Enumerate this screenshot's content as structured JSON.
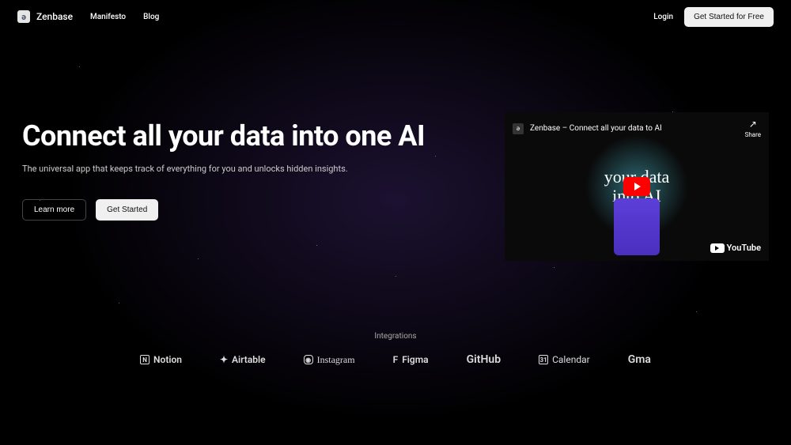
{
  "header": {
    "logo_text": "Zenbase",
    "nav": {
      "manifesto": "Manifesto",
      "blog": "Blog"
    },
    "login": "Login",
    "cta": "Get Started for Free"
  },
  "hero": {
    "title": "Connect all your data into one AI",
    "subtitle": "The universal app that keeps track of everything for you and unlocks hidden insights.",
    "learn_more": "Learn more",
    "get_started": "Get Started"
  },
  "video": {
    "title": "Zenbase – Connect all your data to AI",
    "share": "Share",
    "center_line1": "your data",
    "center_line2": "into AI",
    "youtube": "YouTube"
  },
  "integrations": {
    "label": "Integrations",
    "items": {
      "notion": "Notion",
      "airtable": "Airtable",
      "instagram": "Instagram",
      "figma": "Figma",
      "github": "GitHub",
      "calendar": "Calendar",
      "gmail": "Gma"
    }
  }
}
